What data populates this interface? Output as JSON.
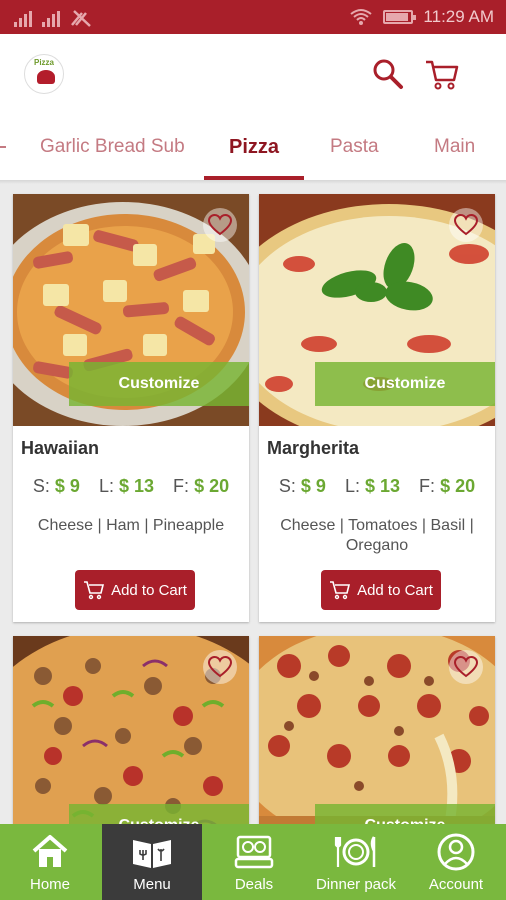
{
  "status_bar": {
    "time": "11:29 AM"
  },
  "app": {
    "logo_text": "Pizza"
  },
  "tabs": [
    {
      "label": "Garlic Bread Sub",
      "active": false
    },
    {
      "label": "Pizza",
      "active": true
    },
    {
      "label": "Pasta",
      "active": false
    },
    {
      "label": "Main",
      "active": false
    }
  ],
  "products": [
    {
      "name": "Hawaiian",
      "customize_label": "Customize",
      "price_s_label": "S:",
      "price_s": "$ 9",
      "price_l_label": "L:",
      "price_l": "$ 13",
      "price_f_label": "F:",
      "price_f": "$ 20",
      "ingredients": "Cheese  |  Ham  |  Pineapple",
      "add_to_cart_label": "Add to Cart"
    },
    {
      "name": "Margherita",
      "customize_label": "Customize",
      "price_s_label": "S:",
      "price_s": "$ 9",
      "price_l_label": "L:",
      "price_l": "$ 13",
      "price_f_label": "F:",
      "price_f": "$ 20",
      "ingredients": "Cheese  |  Tomatoes  |  Basil  |  Oregano",
      "add_to_cart_label": "Add to Cart"
    },
    {
      "customize_label": "Customize"
    },
    {
      "customize_label": "Customize"
    }
  ],
  "bottom_nav": [
    {
      "label": "Home",
      "icon": "home-icon",
      "active": false
    },
    {
      "label": "Menu",
      "icon": "menu-book-icon",
      "active": true
    },
    {
      "label": "Deals",
      "icon": "deals-icon",
      "active": false
    },
    {
      "label": "Dinner pack",
      "icon": "dinner-icon",
      "active": false
    },
    {
      "label": "Account",
      "icon": "account-icon",
      "active": false
    }
  ],
  "colors": {
    "brand_red": "#a91f2a",
    "accent_green": "#7ab83e",
    "price_green": "#6ba832",
    "active_nav": "#3b3b3b"
  }
}
